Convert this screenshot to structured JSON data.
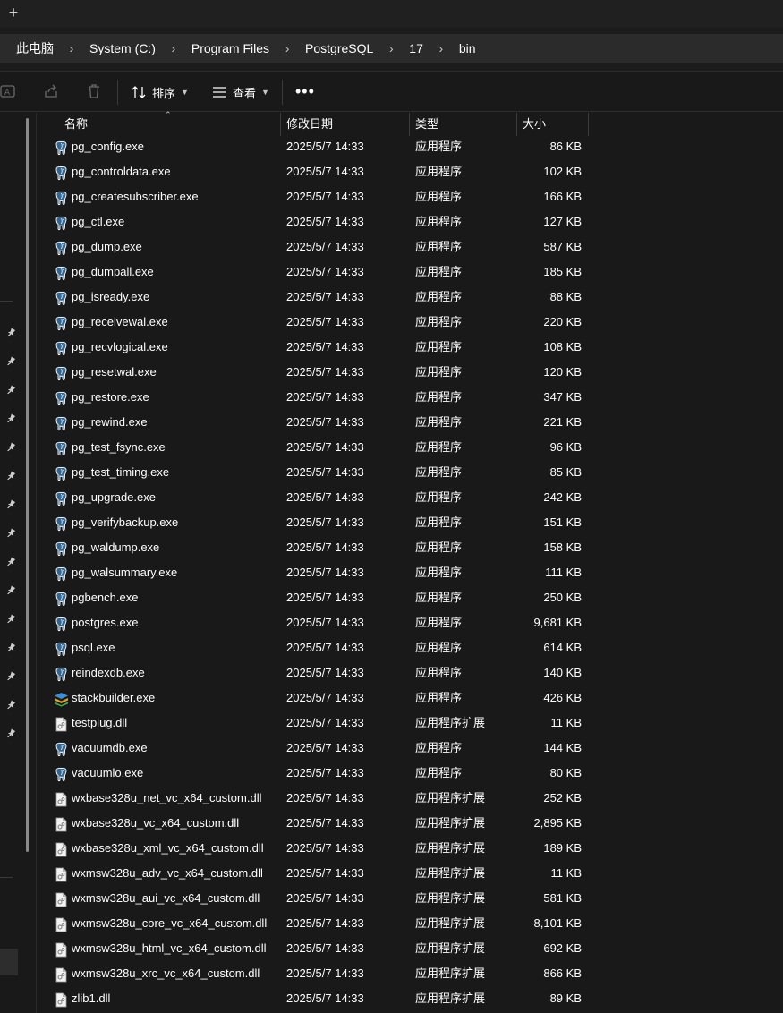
{
  "tabbar": {
    "new_tab_glyph": "+"
  },
  "breadcrumb": [
    "此电脑",
    "System (C:)",
    "Program Files",
    "PostgreSQL",
    "17",
    "bin"
  ],
  "toolbar": {
    "sort_label": "排序",
    "view_label": "查看",
    "more_glyph": "•••",
    "icons": [
      "rename-icon",
      "share-icon",
      "delete-icon",
      "sort-icon",
      "view-icon",
      "more-icon"
    ]
  },
  "columns": {
    "name": "名称",
    "date": "修改日期",
    "type": "类型",
    "size": "大小"
  },
  "files": [
    {
      "name": "pg_config.exe",
      "date": "2025/5/7 14:33",
      "type": "应用程序",
      "size": "86 KB",
      "icon": "elephant"
    },
    {
      "name": "pg_controldata.exe",
      "date": "2025/5/7 14:33",
      "type": "应用程序",
      "size": "102 KB",
      "icon": "elephant"
    },
    {
      "name": "pg_createsubscriber.exe",
      "date": "2025/5/7 14:33",
      "type": "应用程序",
      "size": "166 KB",
      "icon": "elephant"
    },
    {
      "name": "pg_ctl.exe",
      "date": "2025/5/7 14:33",
      "type": "应用程序",
      "size": "127 KB",
      "icon": "elephant"
    },
    {
      "name": "pg_dump.exe",
      "date": "2025/5/7 14:33",
      "type": "应用程序",
      "size": "587 KB",
      "icon": "elephant"
    },
    {
      "name": "pg_dumpall.exe",
      "date": "2025/5/7 14:33",
      "type": "应用程序",
      "size": "185 KB",
      "icon": "elephant"
    },
    {
      "name": "pg_isready.exe",
      "date": "2025/5/7 14:33",
      "type": "应用程序",
      "size": "88 KB",
      "icon": "elephant"
    },
    {
      "name": "pg_receivewal.exe",
      "date": "2025/5/7 14:33",
      "type": "应用程序",
      "size": "220 KB",
      "icon": "elephant"
    },
    {
      "name": "pg_recvlogical.exe",
      "date": "2025/5/7 14:33",
      "type": "应用程序",
      "size": "108 KB",
      "icon": "elephant"
    },
    {
      "name": "pg_resetwal.exe",
      "date": "2025/5/7 14:33",
      "type": "应用程序",
      "size": "120 KB",
      "icon": "elephant"
    },
    {
      "name": "pg_restore.exe",
      "date": "2025/5/7 14:33",
      "type": "应用程序",
      "size": "347 KB",
      "icon": "elephant"
    },
    {
      "name": "pg_rewind.exe",
      "date": "2025/5/7 14:33",
      "type": "应用程序",
      "size": "221 KB",
      "icon": "elephant"
    },
    {
      "name": "pg_test_fsync.exe",
      "date": "2025/5/7 14:33",
      "type": "应用程序",
      "size": "96 KB",
      "icon": "elephant"
    },
    {
      "name": "pg_test_timing.exe",
      "date": "2025/5/7 14:33",
      "type": "应用程序",
      "size": "85 KB",
      "icon": "elephant"
    },
    {
      "name": "pg_upgrade.exe",
      "date": "2025/5/7 14:33",
      "type": "应用程序",
      "size": "242 KB",
      "icon": "elephant"
    },
    {
      "name": "pg_verifybackup.exe",
      "date": "2025/5/7 14:33",
      "type": "应用程序",
      "size": "151 KB",
      "icon": "elephant"
    },
    {
      "name": "pg_waldump.exe",
      "date": "2025/5/7 14:33",
      "type": "应用程序",
      "size": "158 KB",
      "icon": "elephant"
    },
    {
      "name": "pg_walsummary.exe",
      "date": "2025/5/7 14:33",
      "type": "应用程序",
      "size": "111 KB",
      "icon": "elephant"
    },
    {
      "name": "pgbench.exe",
      "date": "2025/5/7 14:33",
      "type": "应用程序",
      "size": "250 KB",
      "icon": "elephant"
    },
    {
      "name": "postgres.exe",
      "date": "2025/5/7 14:33",
      "type": "应用程序",
      "size": "9,681 KB",
      "icon": "elephant"
    },
    {
      "name": "psql.exe",
      "date": "2025/5/7 14:33",
      "type": "应用程序",
      "size": "614 KB",
      "icon": "elephant"
    },
    {
      "name": "reindexdb.exe",
      "date": "2025/5/7 14:33",
      "type": "应用程序",
      "size": "140 KB",
      "icon": "elephant"
    },
    {
      "name": "stackbuilder.exe",
      "date": "2025/5/7 14:33",
      "type": "应用程序",
      "size": "426 KB",
      "icon": "stack"
    },
    {
      "name": "testplug.dll",
      "date": "2025/5/7 14:33",
      "type": "应用程序扩展",
      "size": "11 KB",
      "icon": "dll"
    },
    {
      "name": "vacuumdb.exe",
      "date": "2025/5/7 14:33",
      "type": "应用程序",
      "size": "144 KB",
      "icon": "elephant"
    },
    {
      "name": "vacuumlo.exe",
      "date": "2025/5/7 14:33",
      "type": "应用程序",
      "size": "80 KB",
      "icon": "elephant"
    },
    {
      "name": "wxbase328u_net_vc_x64_custom.dll",
      "date": "2025/5/7 14:33",
      "type": "应用程序扩展",
      "size": "252 KB",
      "icon": "dll"
    },
    {
      "name": "wxbase328u_vc_x64_custom.dll",
      "date": "2025/5/7 14:33",
      "type": "应用程序扩展",
      "size": "2,895 KB",
      "icon": "dll"
    },
    {
      "name": "wxbase328u_xml_vc_x64_custom.dll",
      "date": "2025/5/7 14:33",
      "type": "应用程序扩展",
      "size": "189 KB",
      "icon": "dll"
    },
    {
      "name": "wxmsw328u_adv_vc_x64_custom.dll",
      "date": "2025/5/7 14:33",
      "type": "应用程序扩展",
      "size": "11 KB",
      "icon": "dll"
    },
    {
      "name": "wxmsw328u_aui_vc_x64_custom.dll",
      "date": "2025/5/7 14:33",
      "type": "应用程序扩展",
      "size": "581 KB",
      "icon": "dll"
    },
    {
      "name": "wxmsw328u_core_vc_x64_custom.dll",
      "date": "2025/5/7 14:33",
      "type": "应用程序扩展",
      "size": "8,101 KB",
      "icon": "dll"
    },
    {
      "name": "wxmsw328u_html_vc_x64_custom.dll",
      "date": "2025/5/7 14:33",
      "type": "应用程序扩展",
      "size": "692 KB",
      "icon": "dll"
    },
    {
      "name": "wxmsw328u_xrc_vc_x64_custom.dll",
      "date": "2025/5/7 14:33",
      "type": "应用程序扩展",
      "size": "866 KB",
      "icon": "dll"
    },
    {
      "name": "zlib1.dll",
      "date": "2025/5/7 14:33",
      "type": "应用程序扩展",
      "size": "89 KB",
      "icon": "dll"
    }
  ],
  "colors": {
    "background": "#191919",
    "address_bg": "#2b2b2b",
    "elephant_icon": "#336791",
    "text": "#ffffff"
  }
}
